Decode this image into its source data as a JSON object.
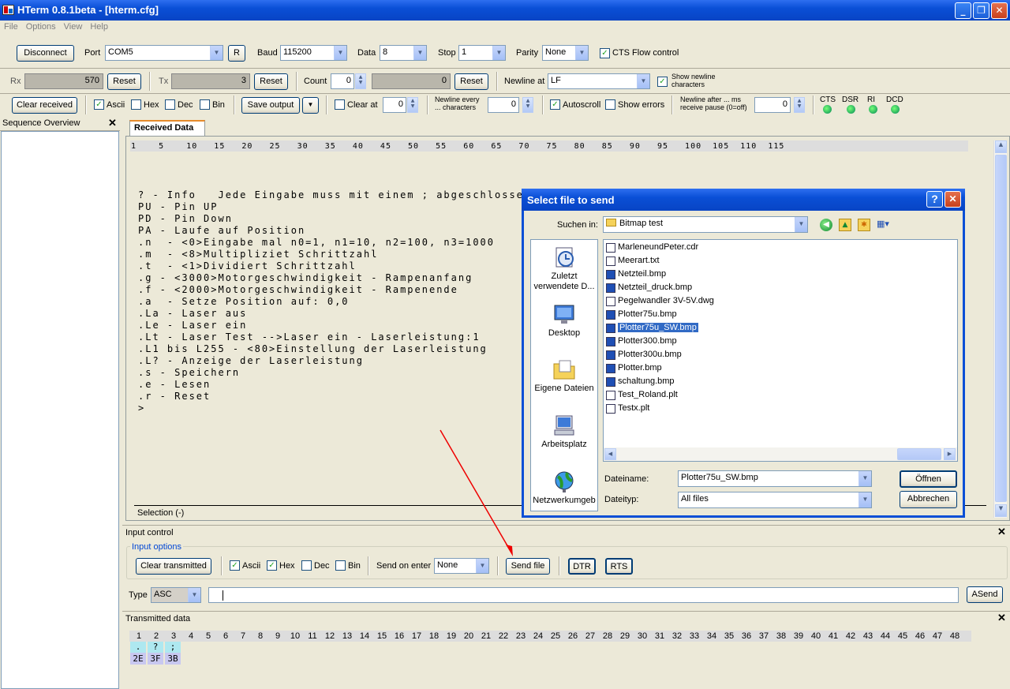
{
  "window": {
    "title": "HTerm 0.8.1beta - [hterm.cfg]"
  },
  "menu": [
    "File",
    "Options",
    "View",
    "Help"
  ],
  "connection": {
    "disconnect_label": "Disconnect",
    "port_label": "Port",
    "port_value": "COM5",
    "r_label": "R",
    "baud_label": "Baud",
    "baud_value": "115200",
    "data_label": "Data",
    "data_value": "8",
    "stop_label": "Stop",
    "stop_value": "1",
    "parity_label": "Parity",
    "parity_value": "None",
    "cts_flow_label": "CTS Flow control"
  },
  "counters": {
    "rx_label": "Rx",
    "rx_value": "570",
    "rx_reset": "Reset",
    "tx_label": "Tx",
    "tx_value": "3",
    "tx_reset": "Reset",
    "count_label": "Count",
    "count_value": "0",
    "count_field": "0",
    "count_reset": "Reset",
    "newline_at_label": "Newline at",
    "newline_at_value": "LF",
    "show_newline_label": "Show newline characters"
  },
  "receive_opts": {
    "clear_received": "Clear received",
    "ascii": "Ascii",
    "hex": "Hex",
    "dec": "Dec",
    "bin": "Bin",
    "save_output": "Save output",
    "clear_at": "Clear at",
    "clear_at_value": "0",
    "newline_every": "Newline every ... characters",
    "newline_every_value": "0",
    "autoscroll": "Autoscroll",
    "show_errors": "Show errors",
    "newline_after": "Newline after ... ms receive pause (0=off)",
    "newline_after_value": "0",
    "cts": "CTS",
    "dsr": "DSR",
    "ri": "RI",
    "dcd": "DCD"
  },
  "sequence": {
    "title": "Sequence Overview"
  },
  "received": {
    "tab": "Received Data",
    "ruler": "1    5    10   15   20   25   30   35   40   45   50   55   60   65   70   75   80   85   90   95   100  105  110  115",
    "lines": [
      "",
      "? - Info   Jede Eingabe muss mit einem ; abgeschlossen werden!",
      "PU - Pin UP",
      "PD - Pin Down",
      "PA - Laufe auf Position",
      ".n  - <0>Eingabe mal n0=1, n1=10, n2=100, n3=1000",
      ".m  - <8>Multipliziet Schrittzahl",
      ".t  - <1>Dividiert Schrittzahl",
      ".g - <3000>Motorgeschwindigkeit - Rampenanfang",
      ".f - <2000>Motorgeschwindigkeit - Rampenende",
      ".a  - Setze Position auf: 0,0",
      ".La - Laser aus",
      ".Le - Laser ein",
      ".Lt - Laser Test -->Laser ein - Laserleistung:1",
      ".L1 bis L255 - <80>Einstellung der Laserleistung",
      ".L? - Anzeige der Laserleistung",
      ".s - Speichern",
      ".e - Lesen",
      ".r - Reset",
      ">"
    ],
    "selection": "Selection (-)"
  },
  "dialog": {
    "title": "Select file to send",
    "look_in_label": "Suchen in:",
    "look_in_value": "Bitmap test",
    "places": [
      "Zuletzt verwendete D...",
      "Desktop",
      "Eigene Dateien",
      "Arbeitsplatz",
      "Netzwerkumgeb"
    ],
    "files": [
      "MarleneundPeter.cdr",
      "Meerart.txt",
      "Netzteil.bmp",
      "Netzteil_druck.bmp",
      "Pegelwandler 3V-5V.dwg",
      "Plotter75u.bmp",
      "Plotter75u_SW.bmp",
      "Plotter300.bmp",
      "Plotter300u.bmp",
      "Plotter.bmp",
      "schaltung.bmp",
      "Test_Roland.plt",
      "Testx.plt"
    ],
    "filename_label": "Dateiname:",
    "filename_value": "Plotter75u_SW.bmp",
    "filetype_label": "Dateityp:",
    "filetype_value": "All files",
    "open": "Öffnen",
    "cancel": "Abbrechen"
  },
  "input_control": {
    "title": "Input control",
    "options_title": "Input options",
    "clear_transmitted": "Clear transmitted",
    "ascii": "Ascii",
    "hex": "Hex",
    "dec": "Dec",
    "bin": "Bin",
    "send_on_enter_label": "Send on enter",
    "send_on_enter_value": "None",
    "send_file": "Send file",
    "dtr": "DTR",
    "rts": "RTS",
    "type_label": "Type",
    "type_value": "ASC",
    "asend": "ASend"
  },
  "transmitted": {
    "title": "Transmitted data",
    "ruler": [
      "1",
      "2",
      "3",
      "4",
      "5",
      "6",
      "7",
      "8",
      "9",
      "10",
      "11",
      "12",
      "13",
      "14",
      "15",
      "16",
      "17",
      "18",
      "19",
      "20",
      "21",
      "22",
      "23",
      "24",
      "25",
      "26",
      "27",
      "28",
      "29",
      "30",
      "31",
      "32",
      "33",
      "34",
      "35",
      "36",
      "37",
      "38",
      "39",
      "40",
      "41",
      "42",
      "43",
      "44",
      "45",
      "46",
      "47",
      "48"
    ],
    "ascii": [
      ".",
      "?",
      ";"
    ],
    "hex": [
      "2E",
      "3F",
      "3B"
    ]
  }
}
